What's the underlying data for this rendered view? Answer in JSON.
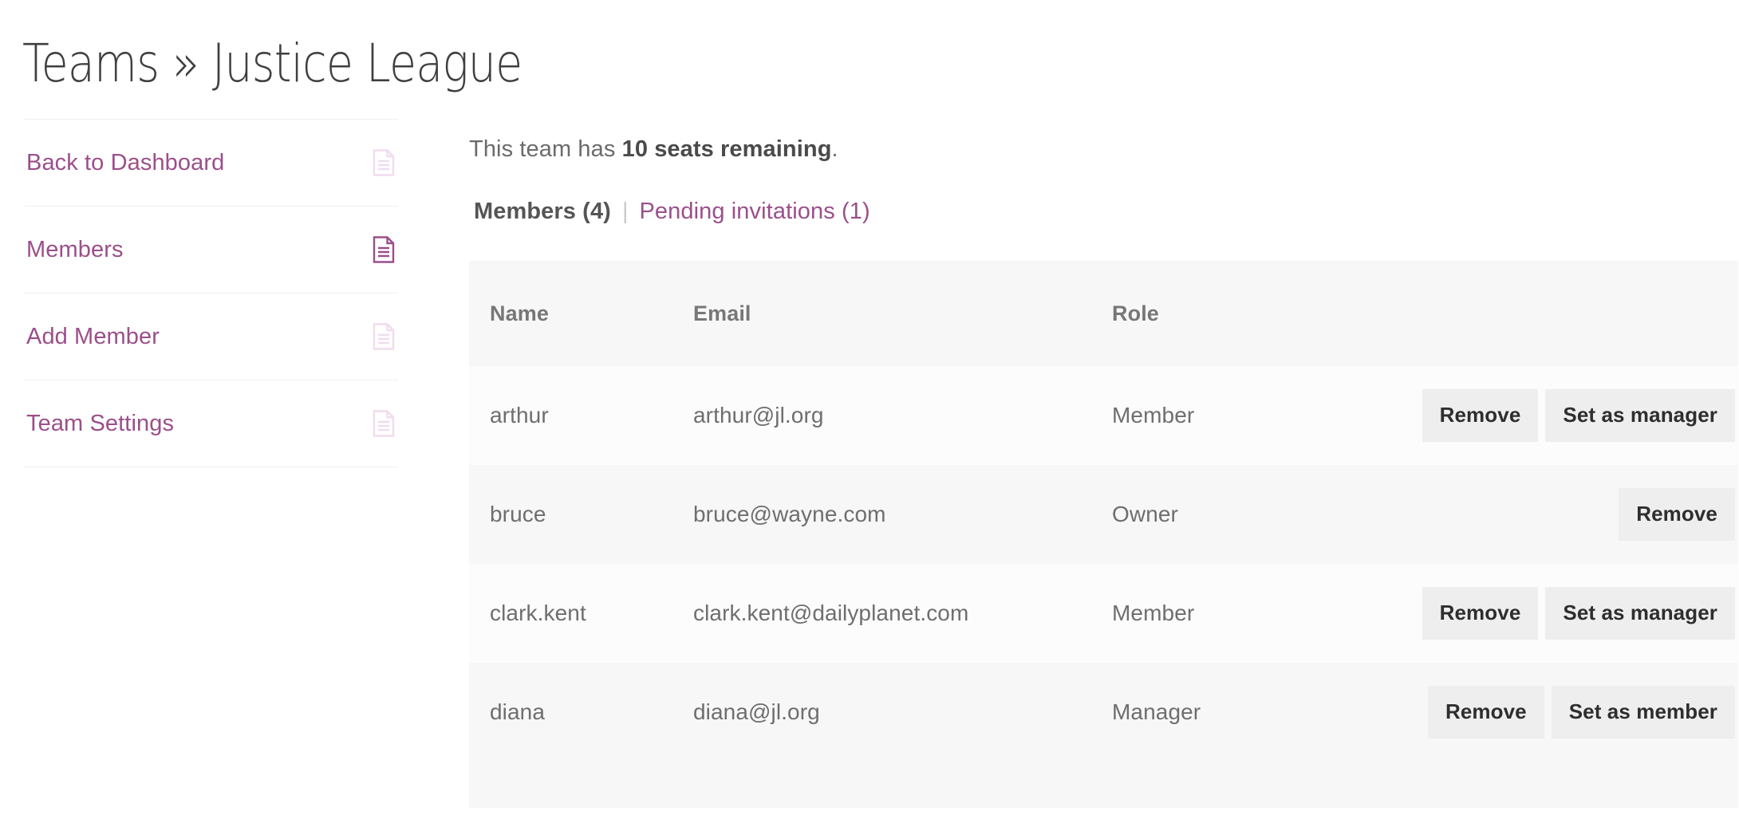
{
  "page": {
    "title": "Teams » Justice League"
  },
  "sidebar": {
    "items": [
      {
        "label": "Back to Dashboard",
        "icon": "document-icon",
        "active": false
      },
      {
        "label": "Members",
        "icon": "document-icon",
        "active": true
      },
      {
        "label": "Add Member",
        "icon": "document-icon",
        "active": false
      },
      {
        "label": "Team Settings",
        "icon": "document-icon",
        "active": false
      }
    ]
  },
  "main": {
    "seats_prefix": "This team has ",
    "seats_bold": "10 seats remaining",
    "seats_suffix": ".",
    "tabs": {
      "active_label": "Members (4)",
      "separator": "|",
      "link_label": "Pending invitations (1)"
    },
    "table": {
      "columns": [
        "Name",
        "Email",
        "Role",
        ""
      ],
      "rows": [
        {
          "name": "arthur",
          "email": "arthur@jl.org",
          "role": "Member",
          "actions": [
            "Remove",
            "Set as manager"
          ]
        },
        {
          "name": "bruce",
          "email": "bruce@wayne.com",
          "role": "Owner",
          "actions": [
            "Remove"
          ]
        },
        {
          "name": "clark.kent",
          "email": "clark.kent@dailyplanet.com",
          "role": "Member",
          "actions": [
            "Remove",
            "Set as manager"
          ]
        },
        {
          "name": "diana",
          "email": "diana@jl.org",
          "role": "Manager",
          "actions": [
            "Remove",
            "Set as member"
          ]
        }
      ]
    }
  },
  "colors": {
    "link": "#9b4f8a",
    "link_muted": "#f0e2ee",
    "title": "#3f3f3f",
    "text": "#6e6e6e",
    "row_odd": "#fcfcfc",
    "row_even": "#f7f7f7",
    "header_bg": "#f7f7f7",
    "button_bg": "#eeeeee",
    "rule": "#eeeeee"
  }
}
